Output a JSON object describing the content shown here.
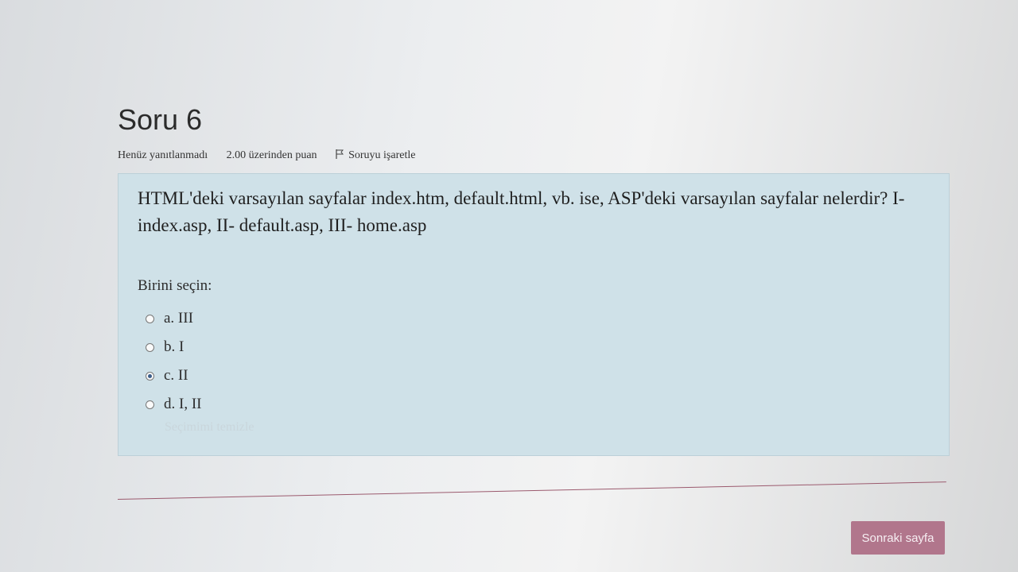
{
  "header": {
    "title": "Soru 6",
    "status": "Henüz yanıtlanmadı",
    "points": "2.00 üzerinden puan",
    "flag_label": "Soruyu işaretle"
  },
  "question": {
    "text": "HTML'deki varsayılan sayfalar index.htm, default.html, vb. ise, ASP'deki varsayılan sayfalar nelerdir? I- index.asp, II- default.asp, III- home.asp",
    "prompt": "Birini seçin:",
    "answers": [
      {
        "label": "a. III",
        "selected": false
      },
      {
        "label": "b. I",
        "selected": false
      },
      {
        "label": "c. II",
        "selected": true
      },
      {
        "label": "d. I, II",
        "selected": false
      }
    ],
    "clear_label": "Seçimimi temizle"
  },
  "footer": {
    "next_label": "Sonraki sayfa"
  },
  "colors": {
    "question_bg": "#cfe1e8",
    "button_bg": "#b1768c",
    "radio_selected": "#3b5d8a"
  }
}
